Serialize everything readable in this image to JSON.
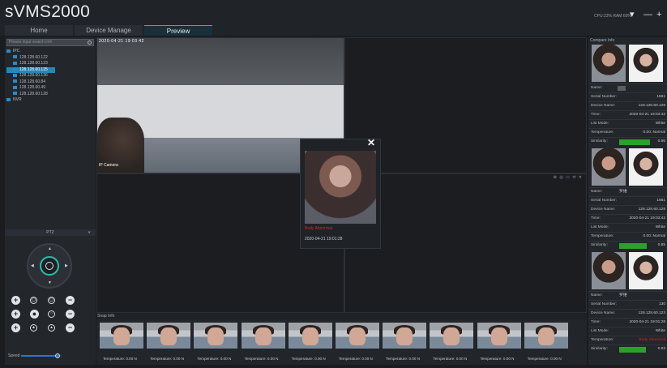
{
  "app": {
    "title": "sVMS2000",
    "sysinfo": "CPU:23%  RAM:60%"
  },
  "window_controls": {
    "menu": "▾",
    "minimize": "—",
    "maximize": "+"
  },
  "tabs": [
    {
      "label": "Home"
    },
    {
      "label": "Device Manage"
    },
    {
      "label": "Preview",
      "active": true
    }
  ],
  "left_panel": {
    "search_placeholder": "Please input search info",
    "tree": {
      "group_ipc": "IPC",
      "devices": [
        "128.128.60.122",
        "128.128.60.123",
        "128.128.60.125",
        "128.128.60.136",
        "128.128.60.84",
        "128.128.60.49",
        "128.128.60.128"
      ],
      "group_nvr": "NVR"
    },
    "ptz": {
      "title": "PTZ",
      "collapse": "∨"
    },
    "speed_label": "Speed",
    "speed_fraction": 0.9
  },
  "video": {
    "cam1_osd": "2020-04-21 19:03:42",
    "cam1_label": "IP Camera",
    "cell_tools": "⊕ ◎ ▭ ⟲ ✕"
  },
  "popup": {
    "close": "✕",
    "alarm_text": "Body Abnormal",
    "time": "2020-04-21 19:01:28"
  },
  "snap": {
    "title": "Snap Info",
    "items": [
      {
        "temp": "Temperature: 0.00   N"
      },
      {
        "temp": "Temperature: 0.00   N"
      },
      {
        "temp": "Temperature: 0.00   N"
      },
      {
        "temp": "Temperature: 0.00   N"
      },
      {
        "temp": "Temperature: 0.00   N"
      },
      {
        "temp": "Temperature: 0.00   N"
      },
      {
        "temp": "Temperature: 0.00   N"
      },
      {
        "temp": "Temperature: 0.00   N"
      },
      {
        "temp": "Temperature: 0.00   N"
      },
      {
        "temp": "Temperature: 0.00   N"
      }
    ]
  },
  "compare": {
    "title": "Compare Info",
    "labels": {
      "name": "Name:",
      "serial": "Serial Number:",
      "device": "Device Name:",
      "time": "Time:",
      "list_mode": "List Mode:",
      "temperature": "Temperature:",
      "similarity": "Similarity:"
    },
    "records": [
      {
        "name": "",
        "serial": "1561",
        "device": "128.128.60.128",
        "time": "2020-04-21 19:03:42",
        "list_mode": "White",
        "temperature": "0.00: Normal",
        "similarity": "0.96",
        "temp_alarm": false
      },
      {
        "name": "罗维",
        "serial": "1561",
        "device": "128.128.60.128",
        "time": "2020-04-21 19:03:42",
        "list_mode": "White",
        "temperature": "0.00: Normal",
        "similarity": "0.85",
        "temp_alarm": false
      },
      {
        "name": "罗维",
        "serial": "130",
        "device": "128.128.60.123",
        "time": "2020-04-21 19:01:28",
        "list_mode": "White",
        "temperature": "Body Abnormal",
        "similarity": "0.83",
        "temp_alarm": true
      }
    ]
  },
  "colors": {
    "accent": "#2cb3c9",
    "selection": "#2687b5",
    "similarity": "#2ca02c",
    "alarm": "#d42a2a"
  },
  "icons": [
    "search-icon",
    "camera-icon",
    "folder-icon",
    "joystick-icon",
    "zoom-in-icon",
    "zoom-out-icon",
    "close-icon"
  ]
}
